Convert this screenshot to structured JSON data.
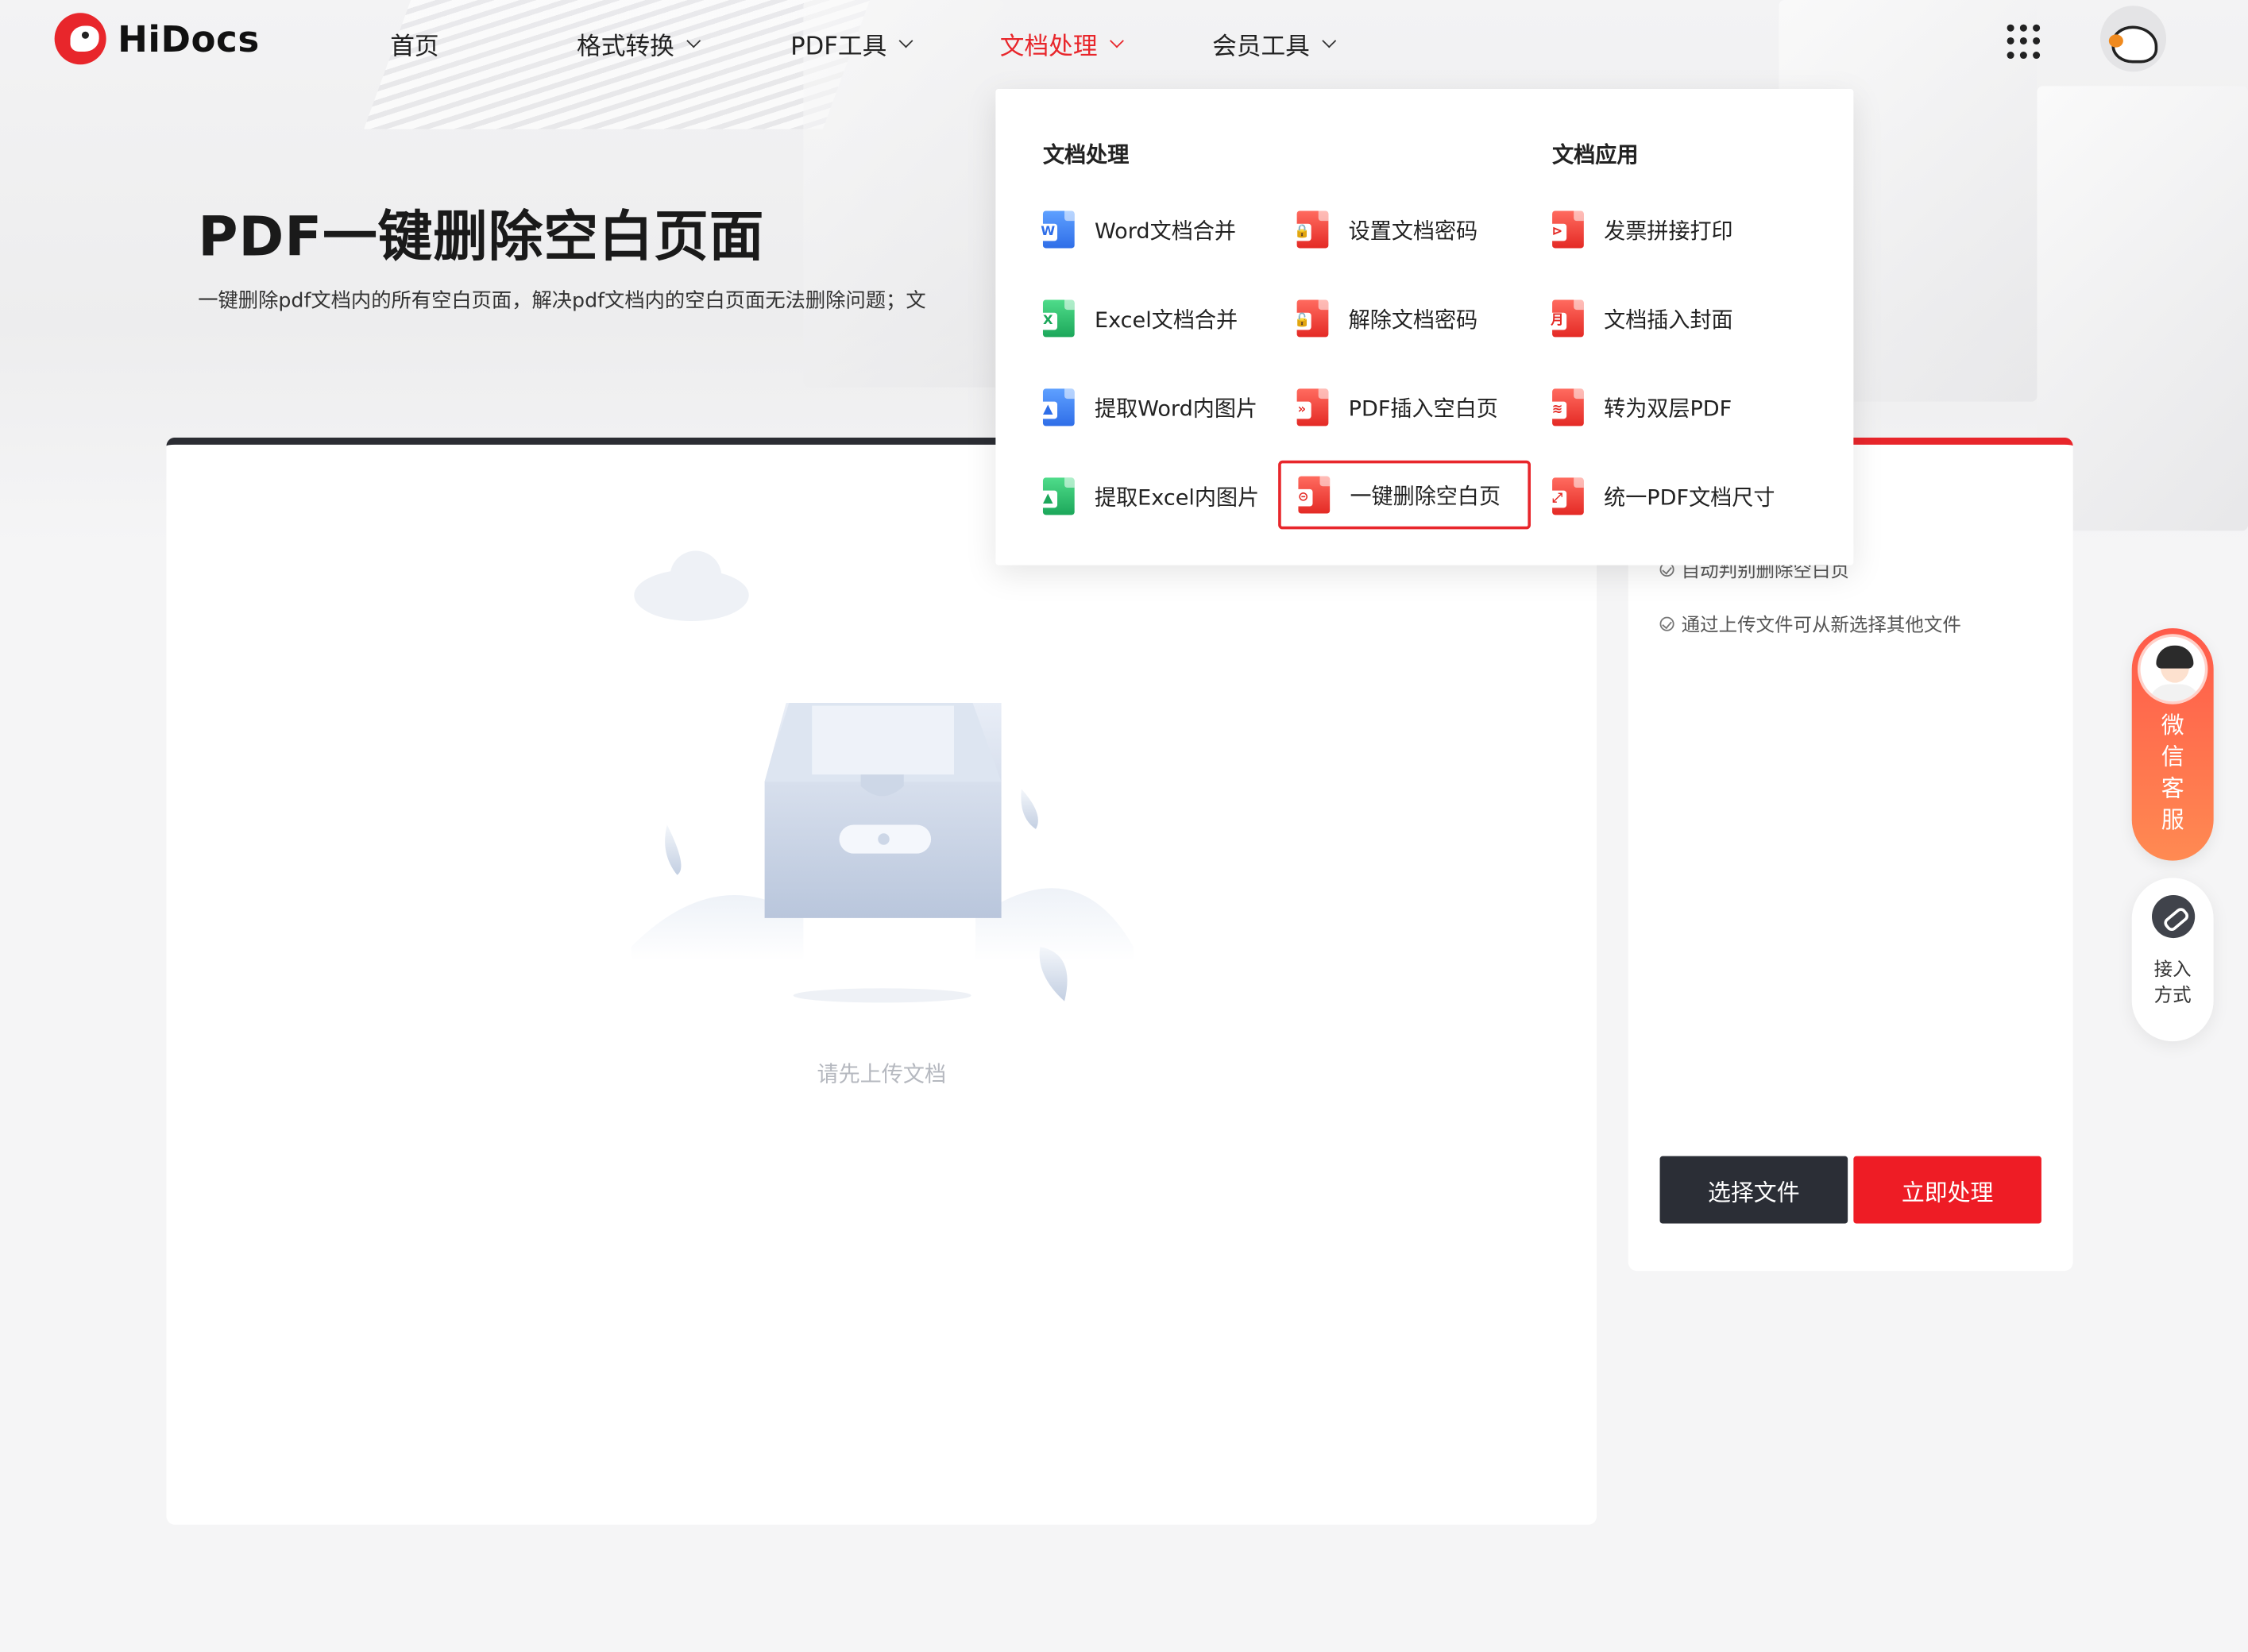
{
  "brand": {
    "name": "HiDocs"
  },
  "nav": {
    "items": [
      {
        "label": "首页",
        "has_dropdown": false,
        "active": false
      },
      {
        "label": "格式转换",
        "has_dropdown": true,
        "active": false
      },
      {
        "label": "PDF工具",
        "has_dropdown": true,
        "active": false
      },
      {
        "label": "文档处理",
        "has_dropdown": true,
        "active": true
      },
      {
        "label": "会员工具",
        "has_dropdown": true,
        "active": false
      }
    ],
    "apps_icon": "grid-dots-icon",
    "avatar_icon": "fox-avatar-icon"
  },
  "hero": {
    "title": "PDF一键删除空白页面",
    "description": "一键删除pdf文档内的所有空白页面，解决pdf文档内的空白页面无法删除问题；文"
  },
  "upload": {
    "hint": "请先上传文档",
    "illustration": "empty-box-illustration"
  },
  "side_panel": {
    "tips": [
      "自动判别删除空白页",
      "通过上传文件可从新选择其他文件"
    ],
    "select_label": "选择文件",
    "process_label": "立即处理"
  },
  "float": {
    "service_label": [
      "微",
      "信",
      "客",
      "服"
    ],
    "access_label": [
      "接入",
      "方式"
    ]
  },
  "dropdown": {
    "col1_header": "文档处理",
    "col3_header": "文档应用",
    "items": [
      {
        "label": "Word文档合并",
        "icon": "word-file-icon",
        "glyph": "W",
        "kind": "word"
      },
      {
        "label": "设置文档密码",
        "icon": "lock-pdf-icon",
        "glyph": "🔒",
        "kind": "pdf"
      },
      {
        "label": "发票拼接打印",
        "icon": "pdf-invoice-icon",
        "glyph": "⊳",
        "kind": "pdf"
      },
      {
        "label": "Excel文档合并",
        "icon": "excel-file-icon",
        "glyph": "X",
        "kind": "excel"
      },
      {
        "label": "解除文档密码",
        "icon": "unlock-pdf-icon",
        "glyph": "🔓",
        "kind": "pdf"
      },
      {
        "label": "文档插入封面",
        "icon": "pdf-cover-icon",
        "glyph": "月",
        "kind": "pdf"
      },
      {
        "label": "提取Word内图片",
        "icon": "word-image-icon",
        "glyph": "▲",
        "kind": "img-blue"
      },
      {
        "label": "PDF插入空白页",
        "icon": "pdf-insert-icon",
        "glyph": "»",
        "kind": "pdf"
      },
      {
        "label": "转为双层PDF",
        "icon": "pdf-layers-icon",
        "glyph": "≋",
        "kind": "pdf"
      },
      {
        "label": "提取Excel内图片",
        "icon": "excel-image-icon",
        "glyph": "▲",
        "kind": "img-green"
      },
      {
        "label": "一键删除空白页",
        "icon": "pdf-remove-icon",
        "glyph": "⊝",
        "kind": "pdf",
        "selected": true
      },
      {
        "label": "统一PDF文档尺寸",
        "icon": "pdf-resize-icon",
        "glyph": "⤢",
        "kind": "pdf"
      }
    ]
  }
}
